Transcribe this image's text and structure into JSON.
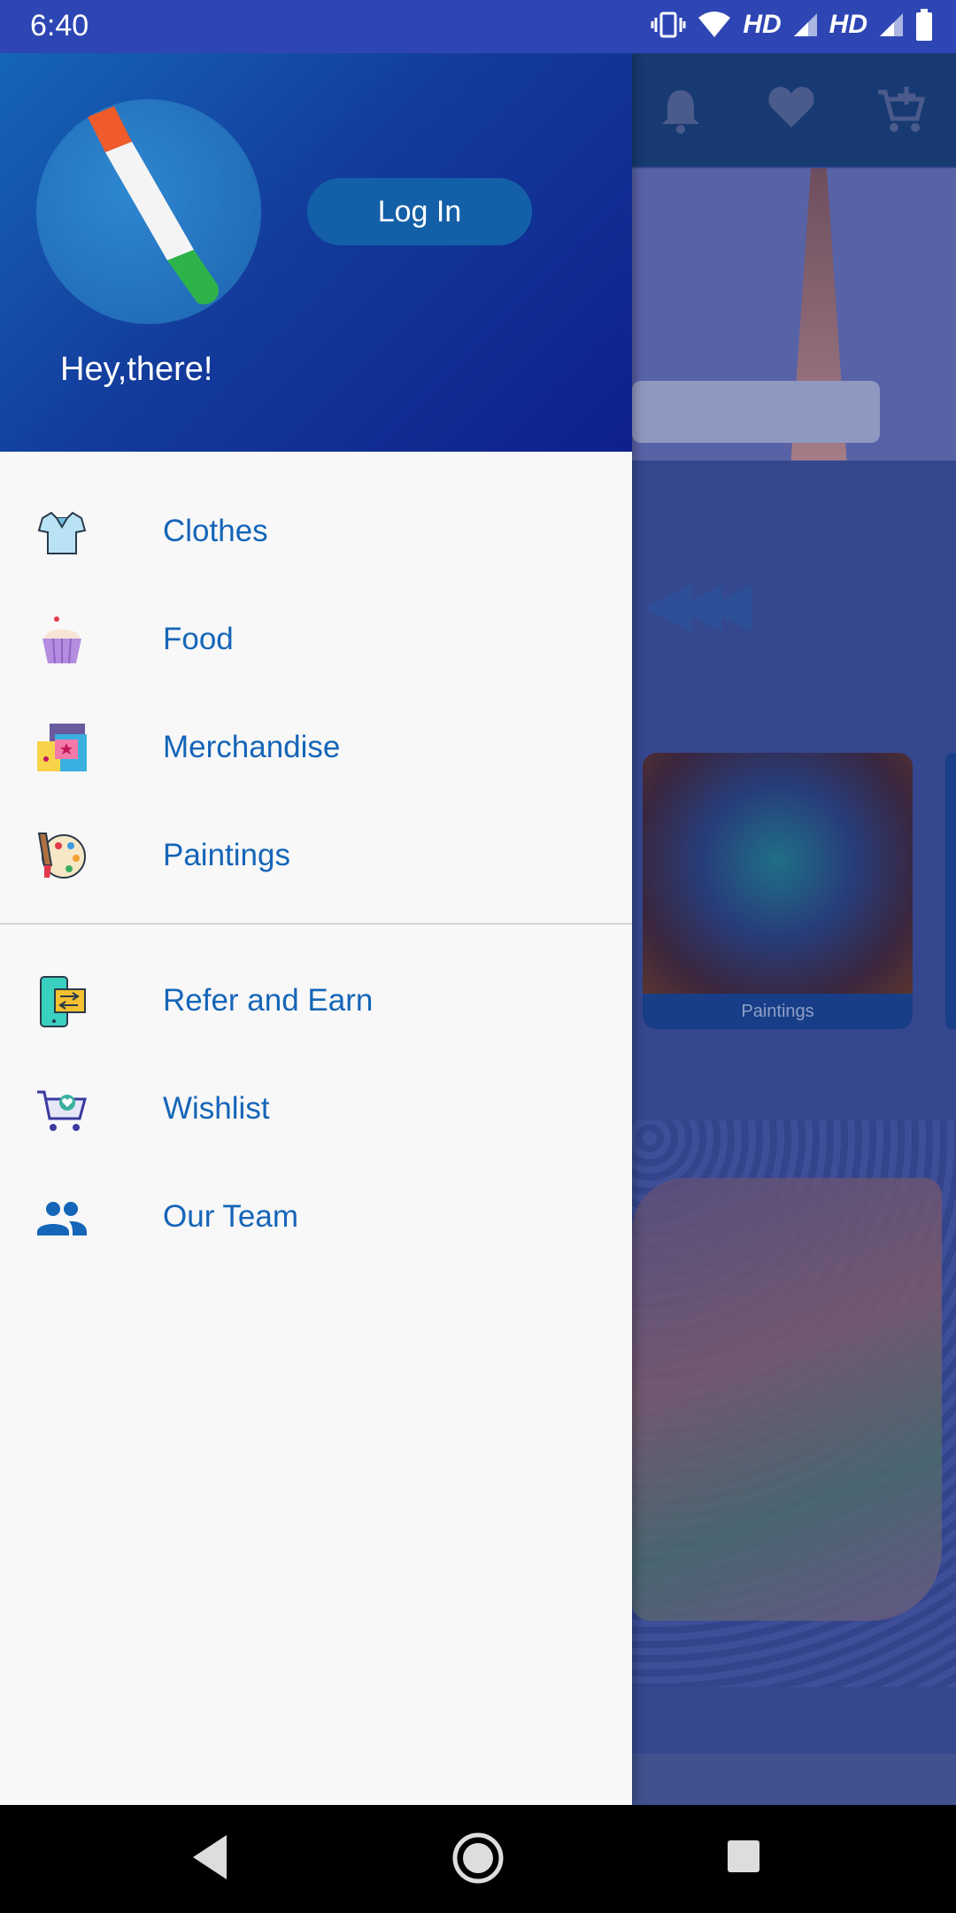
{
  "status_bar": {
    "time": "6:40",
    "net1": "HD",
    "net2": "HD"
  },
  "header": {
    "login_label": "Log In",
    "greeting": "Hey,there!"
  },
  "menu": {
    "items": [
      {
        "label": "Clothes",
        "icon": "shirt-icon"
      },
      {
        "label": "Food",
        "icon": "cupcake-icon"
      },
      {
        "label": "Merchandise",
        "icon": "shopping-bags-icon"
      },
      {
        "label": "Paintings",
        "icon": "palette-icon"
      }
    ],
    "extra_items": [
      {
        "label": "Refer and Earn",
        "icon": "refer-phone-icon"
      },
      {
        "label": "Wishlist",
        "icon": "cart-heart-icon"
      },
      {
        "label": "Our Team",
        "icon": "people-icon"
      }
    ]
  },
  "background": {
    "card_label": "Paintings"
  },
  "colors": {
    "drawer_header_start": "#1565b8",
    "drawer_header_end": "#0e1f8c",
    "menu_text": "#1565b8",
    "status_bar": "#2e46b4"
  }
}
